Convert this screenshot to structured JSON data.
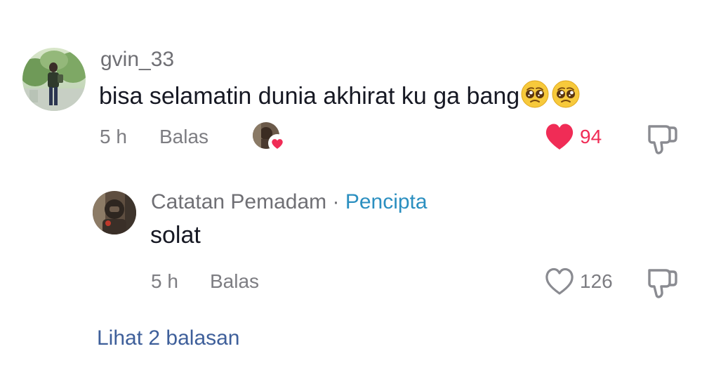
{
  "comment": {
    "username": "gvin_33",
    "text": "bisa selamatin dunia akhirat ku ga bang",
    "emojis": [
      "pleading-face-emoji",
      "pleading-face-emoji"
    ],
    "time": "5 h",
    "reply_label": "Balas",
    "creator_liked": true,
    "liked": true,
    "like_count": "94",
    "colors": {
      "liked_heart": "#f02c56",
      "liked_count": "#f02c56"
    }
  },
  "reply": {
    "username": "Catatan Pemadam",
    "separator": "·",
    "creator_label": "Pencipta",
    "text": "solat",
    "time": "5 h",
    "reply_label": "Balas",
    "liked": false,
    "like_count": "126",
    "colors": {
      "creator_label": "#2b8fc0"
    }
  },
  "view_replies_label": "Lihat 2 balasan"
}
